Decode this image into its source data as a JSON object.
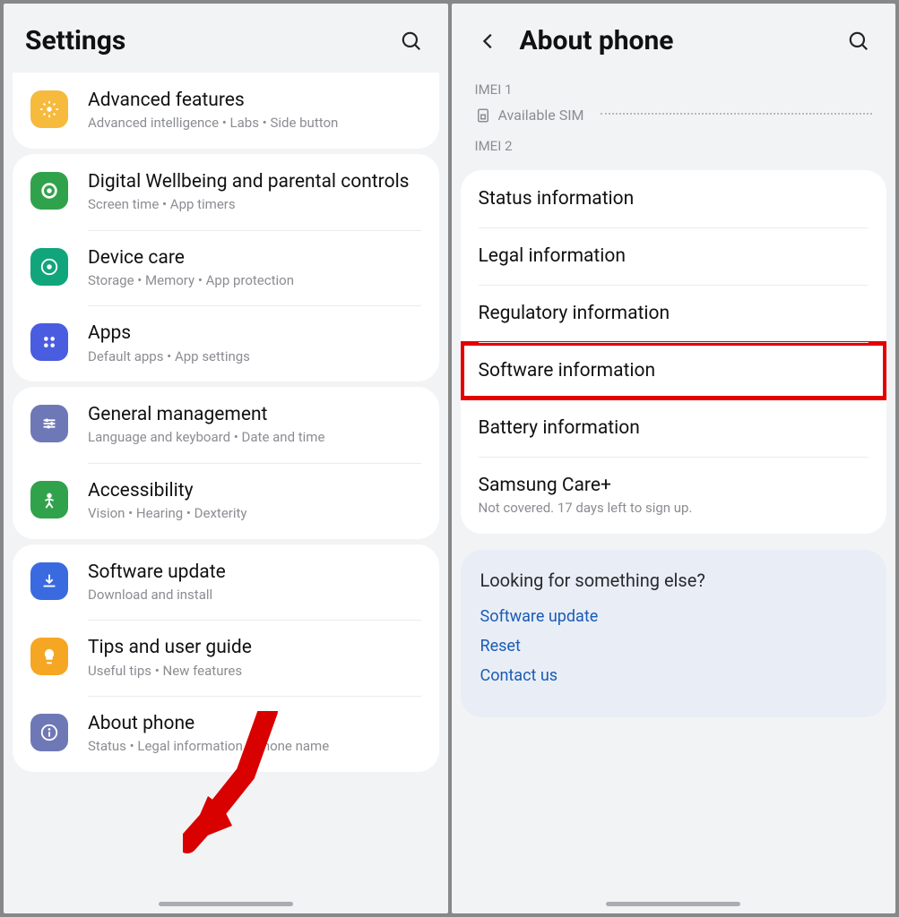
{
  "left": {
    "title": "Settings",
    "groups": [
      {
        "cutTop": true,
        "items": [
          {
            "icon": "gear",
            "bg": "#f6ba3d",
            "title": "Advanced features",
            "sub": "Advanced intelligence  •  Labs  •  Side button"
          }
        ]
      },
      {
        "items": [
          {
            "icon": "ring",
            "bg": "#31a24c",
            "title": "Digital Wellbeing and parental controls",
            "sub": "Screen time  •  App timers"
          },
          {
            "icon": "target",
            "bg": "#11a57c",
            "title": "Device care",
            "sub": "Storage  •  Memory  •  App protection"
          },
          {
            "icon": "grid4",
            "bg": "#4a5de0",
            "title": "Apps",
            "sub": "Default apps  •  App settings"
          }
        ]
      },
      {
        "items": [
          {
            "icon": "sliders",
            "bg": "#6f78b6",
            "title": "General management",
            "sub": "Language and keyboard  •  Date and time"
          },
          {
            "icon": "person",
            "bg": "#31a24c",
            "title": "Accessibility",
            "sub": "Vision  •  Hearing  •  Dexterity"
          }
        ]
      },
      {
        "items": [
          {
            "icon": "download",
            "bg": "#3a6ae0",
            "title": "Software update",
            "sub": "Download and install"
          },
          {
            "icon": "bulb",
            "bg": "#f5a623",
            "title": "Tips and user guide",
            "sub": "Useful tips  •  New features"
          },
          {
            "icon": "info",
            "bg": "#6f78b6",
            "title": "About phone",
            "sub": "Status  •  Legal information  •  Phone name"
          }
        ]
      }
    ]
  },
  "right": {
    "title": "About phone",
    "imei1": "IMEI 1",
    "availableSim": "Available SIM",
    "imei2": "IMEI 2",
    "info": [
      {
        "title": "Status information"
      },
      {
        "title": "Legal information"
      },
      {
        "title": "Regulatory information"
      },
      {
        "title": "Software information",
        "highlight": true
      },
      {
        "title": "Battery information"
      },
      {
        "title": "Samsung Care+",
        "sub": "Not covered. 17 days left to sign up."
      }
    ],
    "else": {
      "heading": "Looking for something else?",
      "links": [
        "Software update",
        "Reset",
        "Contact us"
      ]
    }
  }
}
